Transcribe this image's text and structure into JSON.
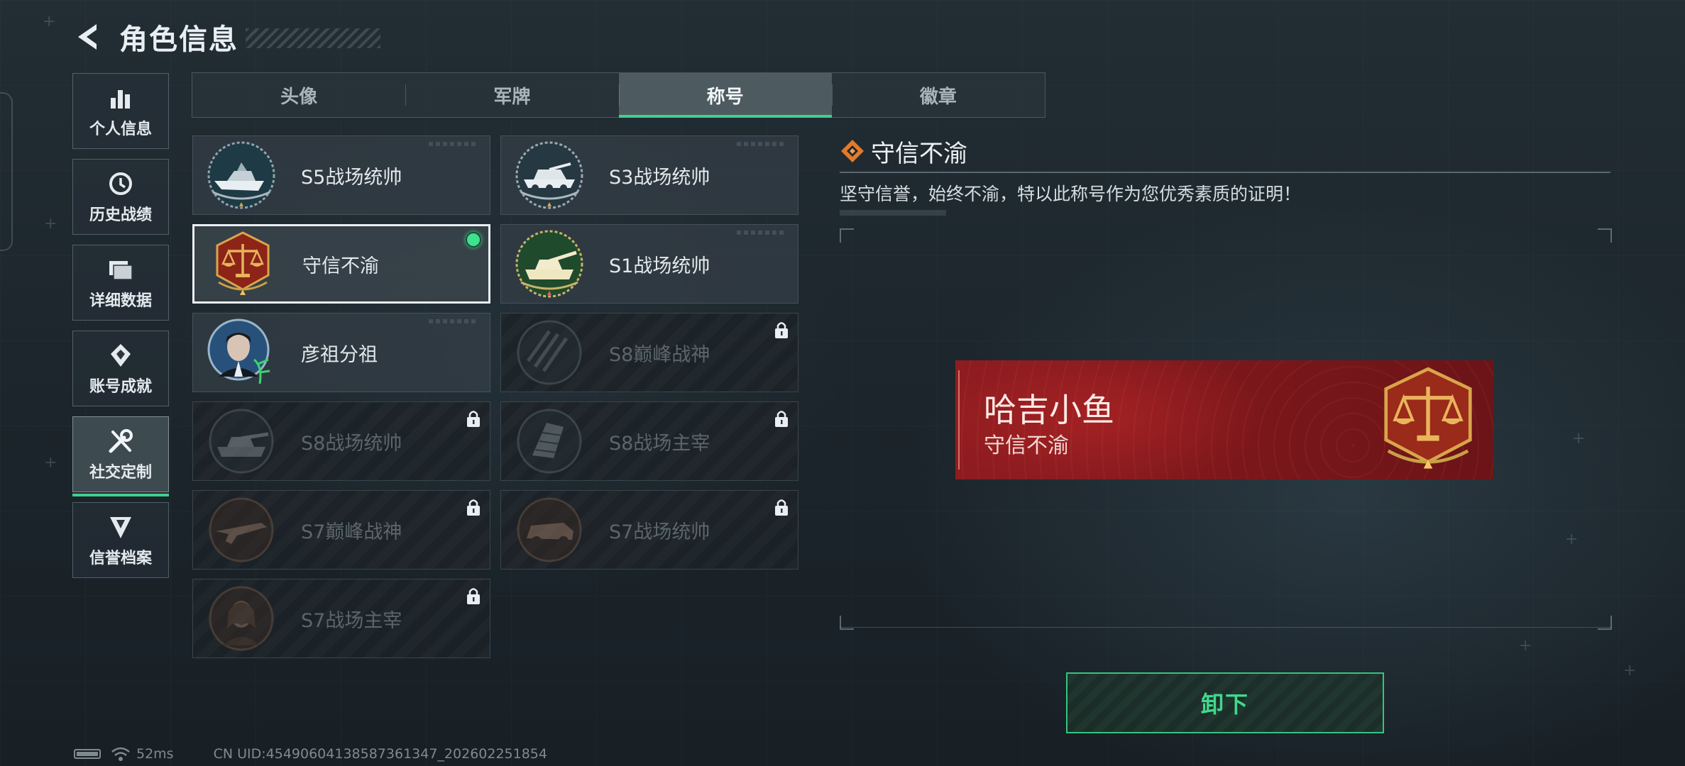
{
  "header": {
    "title": "角色信息",
    "back_icon": "back-arrow-icon"
  },
  "sidebar": {
    "items": [
      {
        "label": "个人信息",
        "icon": "bar-chart-icon",
        "active": false
      },
      {
        "label": "历史战绩",
        "icon": "history-clock-icon",
        "active": false
      },
      {
        "label": "详细数据",
        "icon": "folder-icon",
        "active": false
      },
      {
        "label": "账号成就",
        "icon": "achievement-icon",
        "active": false
      },
      {
        "label": "社交定制",
        "icon": "tools-icon",
        "active": true
      },
      {
        "label": "信誉档案",
        "icon": "credit-shield-icon",
        "active": false
      }
    ]
  },
  "tabs": [
    {
      "label": "头像",
      "active": false
    },
    {
      "label": "军牌",
      "active": false
    },
    {
      "label": "称号",
      "active": true
    },
    {
      "label": "徽章",
      "active": false
    }
  ],
  "cards": [
    {
      "name": "S5战场统帅",
      "icon": "speedboat-emblem-icon",
      "locked": false,
      "selected": false,
      "equipped": false
    },
    {
      "name": "S3战场统帅",
      "icon": "armored-vehicle-emblem-icon",
      "locked": false,
      "selected": false,
      "equipped": false
    },
    {
      "name": "守信不渝",
      "icon": "justice-scales-emblem-icon",
      "locked": false,
      "selected": true,
      "equipped": true
    },
    {
      "name": "S1战场统帅",
      "icon": "tank-emblem-icon",
      "locked": false,
      "selected": false,
      "equipped": false
    },
    {
      "name": "彦祖分祖",
      "icon": "portrait-emblem-icon",
      "locked": false,
      "selected": false,
      "equipped": false
    },
    {
      "name": "S8巅峰战神",
      "icon": "stripe-emblem-icon",
      "locked": true,
      "selected": false,
      "equipped": false
    },
    {
      "name": "S8战场统帅",
      "icon": "tank-emblem-icon",
      "locked": true,
      "selected": false,
      "equipped": false
    },
    {
      "name": "S8战场主宰",
      "icon": "missile-launcher-emblem-icon",
      "locked": true,
      "selected": false,
      "equipped": false
    },
    {
      "name": "S7巅峰战神",
      "icon": "rifle-emblem-icon",
      "locked": true,
      "selected": false,
      "equipped": false
    },
    {
      "name": "S7战场统帅",
      "icon": "jeep-emblem-icon",
      "locked": true,
      "selected": false,
      "equipped": false
    },
    {
      "name": "S7战场主宰",
      "icon": "soldier-portrait-emblem-icon",
      "locked": true,
      "selected": false,
      "equipped": false
    }
  ],
  "detail": {
    "title": "守信不渝",
    "description": "坚守信誉，始终不渝，特以此称号作为您优秀素质的证明！",
    "title_icon": "diamond-icon"
  },
  "nameplate": {
    "player_name": "哈吉小鱼",
    "title": "守信不渝",
    "emblem": "justice-scales-emblem-icon"
  },
  "action": {
    "label": "卸下"
  },
  "status": {
    "ping": "52ms",
    "uid": "CN UID:45490604138587361347_202602251854"
  },
  "colors": {
    "accent": "#3fcf8e",
    "nameplate_red": "#8e1c20",
    "emblem_gold": "#d9a54a"
  }
}
